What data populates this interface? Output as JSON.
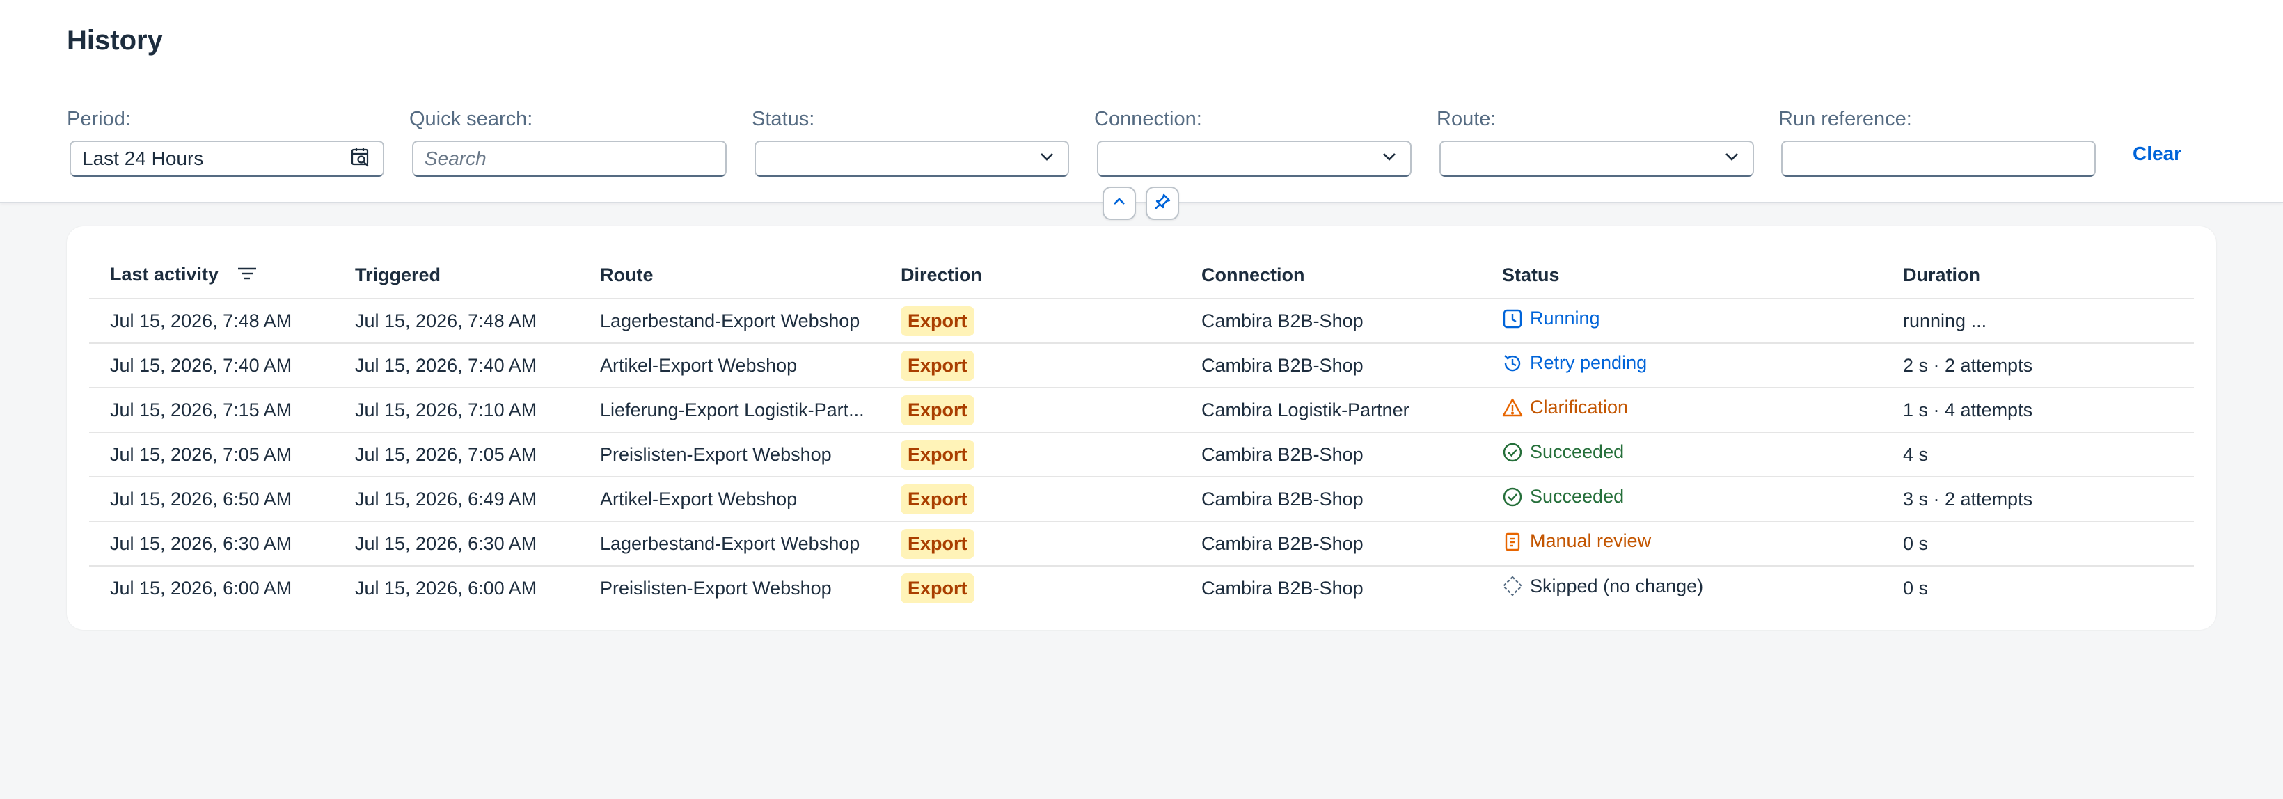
{
  "page": {
    "title": "History"
  },
  "filters": {
    "period": {
      "label": "Period:",
      "value": "Last 24 Hours"
    },
    "quick_search": {
      "label": "Quick search:",
      "placeholder": "Search"
    },
    "status": {
      "label": "Status:",
      "value": ""
    },
    "connection": {
      "label": "Connection:",
      "value": ""
    },
    "route": {
      "label": "Route:",
      "value": ""
    },
    "run_reference": {
      "label": "Run reference:",
      "value": ""
    },
    "clear_label": "Clear"
  },
  "colors": {
    "accent": "#0064d9",
    "running": "#0064d9",
    "warning": "#e76500",
    "success": "#256f3a",
    "neutral": "#1d2d3e",
    "badge_bg": "#fff3b8",
    "badge_text": "#a93e00"
  },
  "table": {
    "columns": [
      "Last activity",
      "Triggered",
      "Route",
      "Direction",
      "Connection",
      "Status",
      "Duration"
    ],
    "rows": [
      {
        "last_activity": "Jul 15, 2026, 7:48 AM",
        "triggered": "Jul 15, 2026, 7:48 AM",
        "route": "Lagerbestand-Export Webshop",
        "direction": "Export",
        "connection": "Cambira B2B-Shop",
        "status": "Running",
        "status_icon": "clock-icon",
        "duration": "running ..."
      },
      {
        "last_activity": "Jul 15, 2026, 7:40 AM",
        "triggered": "Jul 15, 2026, 7:40 AM",
        "route": "Artikel-Export Webshop",
        "direction": "Export",
        "connection": "Cambira B2B-Shop",
        "status": "Retry pending",
        "status_icon": "history-icon",
        "duration": "2 s · 2 attempts"
      },
      {
        "last_activity": "Jul 15, 2026, 7:15 AM",
        "triggered": "Jul 15, 2026, 7:10 AM",
        "route": "Lieferung-Export Logistik-Part...",
        "direction": "Export",
        "connection": "Cambira Logistik-Partner",
        "status": "Clarification",
        "status_icon": "warning-icon",
        "duration": "1 s · 4 attempts"
      },
      {
        "last_activity": "Jul 15, 2026, 7:05 AM",
        "triggered": "Jul 15, 2026, 7:05 AM",
        "route": "Preislisten-Export Webshop",
        "direction": "Export",
        "connection": "Cambira B2B-Shop",
        "status": "Succeeded",
        "status_icon": "check-circle-icon",
        "duration": "4 s"
      },
      {
        "last_activity": "Jul 15, 2026, 6:50 AM",
        "triggered": "Jul 15, 2026, 6:49 AM",
        "route": "Artikel-Export Webshop",
        "direction": "Export",
        "connection": "Cambira B2B-Shop",
        "status": "Succeeded",
        "status_icon": "check-circle-icon",
        "duration": "3 s · 2 attempts"
      },
      {
        "last_activity": "Jul 15, 2026, 6:30 AM",
        "triggered": "Jul 15, 2026, 6:30 AM",
        "route": "Lagerbestand-Export Webshop",
        "direction": "Export",
        "connection": "Cambira B2B-Shop",
        "status": "Manual review",
        "status_icon": "clipboard-icon",
        "duration": "0 s"
      },
      {
        "last_activity": "Jul 15, 2026, 6:00 AM",
        "triggered": "Jul 15, 2026, 6:00 AM",
        "route": "Preislisten-Export Webshop",
        "direction": "Export",
        "connection": "Cambira B2B-Shop",
        "status": "Skipped (no change)",
        "status_icon": "dashed-diamond-icon",
        "duration": "0 s"
      }
    ]
  }
}
